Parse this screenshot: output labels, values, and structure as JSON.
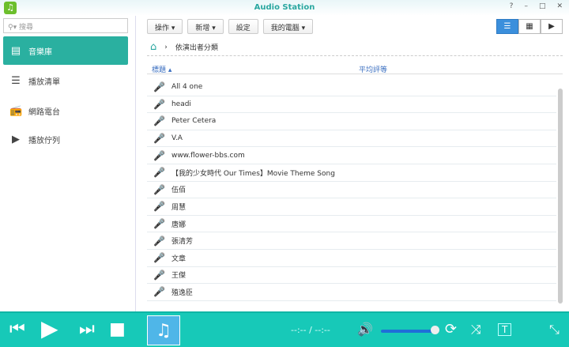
{
  "window": {
    "title": "Audio Station",
    "help": "?",
    "minimize": "–",
    "maximize": "□",
    "close": "✕"
  },
  "sidebar": {
    "search_placeholder": "搜尋",
    "items": [
      {
        "label": "音樂庫",
        "icon": "library-icon"
      },
      {
        "label": "播放清單",
        "icon": "playlist-icon"
      },
      {
        "label": "網路電台",
        "icon": "radio-icon"
      },
      {
        "label": "播放佇列",
        "icon": "queue-icon"
      }
    ]
  },
  "toolbar": {
    "action": "操作 ▾",
    "new": "新增 ▾",
    "settings": "設定",
    "mycomputer": "我的電腦 ▾"
  },
  "breadcrumb": {
    "current": "依演出者分類"
  },
  "table": {
    "col_title": "標題 ▴",
    "col_rating": "平均評等"
  },
  "artists": [
    "All 4 one",
    "headi",
    "Peter Cetera",
    "V.A",
    "www.flower-bbs.com",
    "【我的少女時代 Our Times】Movie Theme Song",
    "伍佰",
    "周慧",
    "唐娜",
    "張清芳",
    "文章",
    "王傑",
    "殖逸臣"
  ],
  "player": {
    "time": "--:-- / --:--",
    "volume": 1.0
  }
}
